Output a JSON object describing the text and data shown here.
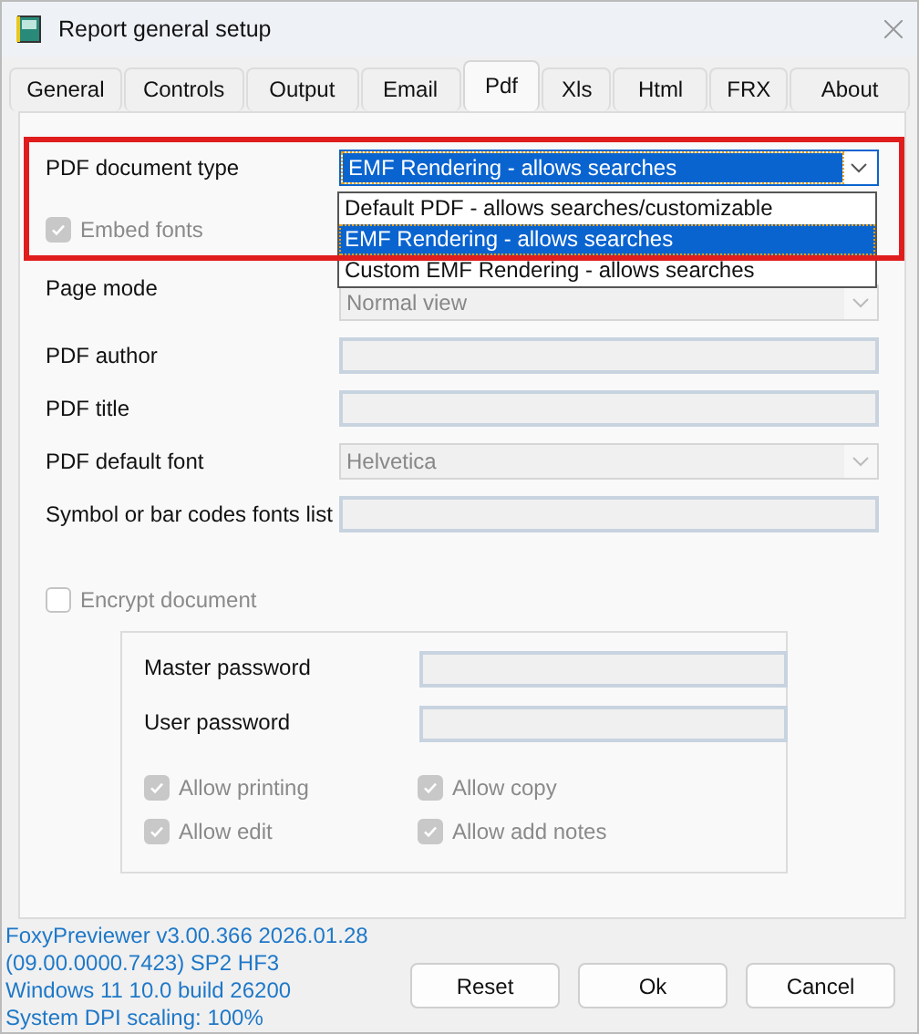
{
  "window": {
    "title": "Report general setup"
  },
  "tabs": [
    {
      "label": "General",
      "selected": false
    },
    {
      "label": "Controls",
      "selected": false
    },
    {
      "label": "Output",
      "selected": false
    },
    {
      "label": "Email",
      "selected": false
    },
    {
      "label": "Pdf",
      "selected": true
    },
    {
      "label": "Xls",
      "selected": false
    },
    {
      "label": "Html",
      "selected": false
    },
    {
      "label": "FRX",
      "selected": false
    },
    {
      "label": "About",
      "selected": false
    }
  ],
  "pdf_document_type": {
    "label": "PDF document type",
    "value": "EMF Rendering - allows searches",
    "expanded": true,
    "options": [
      {
        "label": "Default PDF - allows searches/customizable",
        "selected": false
      },
      {
        "label": "EMF Rendering - allows searches",
        "selected": true
      },
      {
        "label": "Custom EMF Rendering - allows searches",
        "selected": false
      }
    ]
  },
  "embed_fonts": {
    "label": "Embed fonts",
    "checked": true
  },
  "fields": [
    {
      "kind": "combo",
      "label": "Page mode",
      "value": "Normal view"
    },
    {
      "kind": "text",
      "label": "PDF author"
    },
    {
      "kind": "text",
      "label": "PDF title"
    },
    {
      "kind": "combo",
      "label": "PDF default font",
      "value": "Helvetica"
    },
    {
      "kind": "text",
      "label": "Symbol or bar codes fonts list"
    }
  ],
  "encrypt": {
    "label": "Encrypt document",
    "checked": false
  },
  "passwords": [
    {
      "label": "Master password"
    },
    {
      "label": "User password"
    }
  ],
  "permissions": [
    {
      "label": "Allow printing",
      "checked": true
    },
    {
      "label": "Allow copy",
      "checked": true
    },
    {
      "label": "Allow edit",
      "checked": true
    },
    {
      "label": "Allow add notes",
      "checked": true
    }
  ],
  "version_info": [
    "FoxyPreviewer v3.00.366 2026.01.28",
    "(09.00.0000.7423) SP2 HF3",
    "Windows 11 10.0 build 26200",
    "System DPI scaling: 100%"
  ],
  "buttons": [
    "Reset",
    "Ok",
    "Cancel"
  ]
}
